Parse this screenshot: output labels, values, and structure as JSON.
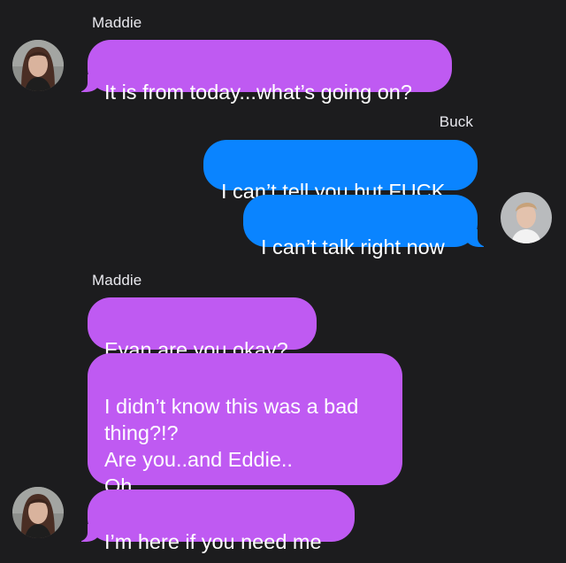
{
  "conversation": {
    "participants": {
      "maddie": {
        "name": "Maddie",
        "bubble_color": "#bf5af2"
      },
      "buck": {
        "name": "Buck",
        "bubble_color": "#0a84ff"
      }
    },
    "groups": [
      {
        "sender_label": "Maddie",
        "messages": [
          {
            "text": "It is from today...what’s going on?"
          }
        ]
      },
      {
        "sender_label": "Buck",
        "messages": [
          {
            "text": "I can’t tell you but FUCK"
          },
          {
            "text": "I can’t talk right now"
          }
        ]
      },
      {
        "sender_label": "Maddie",
        "messages": [
          {
            "text": "Evan are you okay?"
          },
          {
            "text": "I didn’t know this was a bad\nthing?!?\nAre you..and Eddie..\nOh"
          },
          {
            "text": "I’m here if you need me"
          }
        ]
      }
    ]
  },
  "background_color": "#1c1c1e",
  "icons": {
    "maddie_avatar": "maddie-avatar-icon",
    "buck_avatar": "buck-avatar-icon"
  }
}
